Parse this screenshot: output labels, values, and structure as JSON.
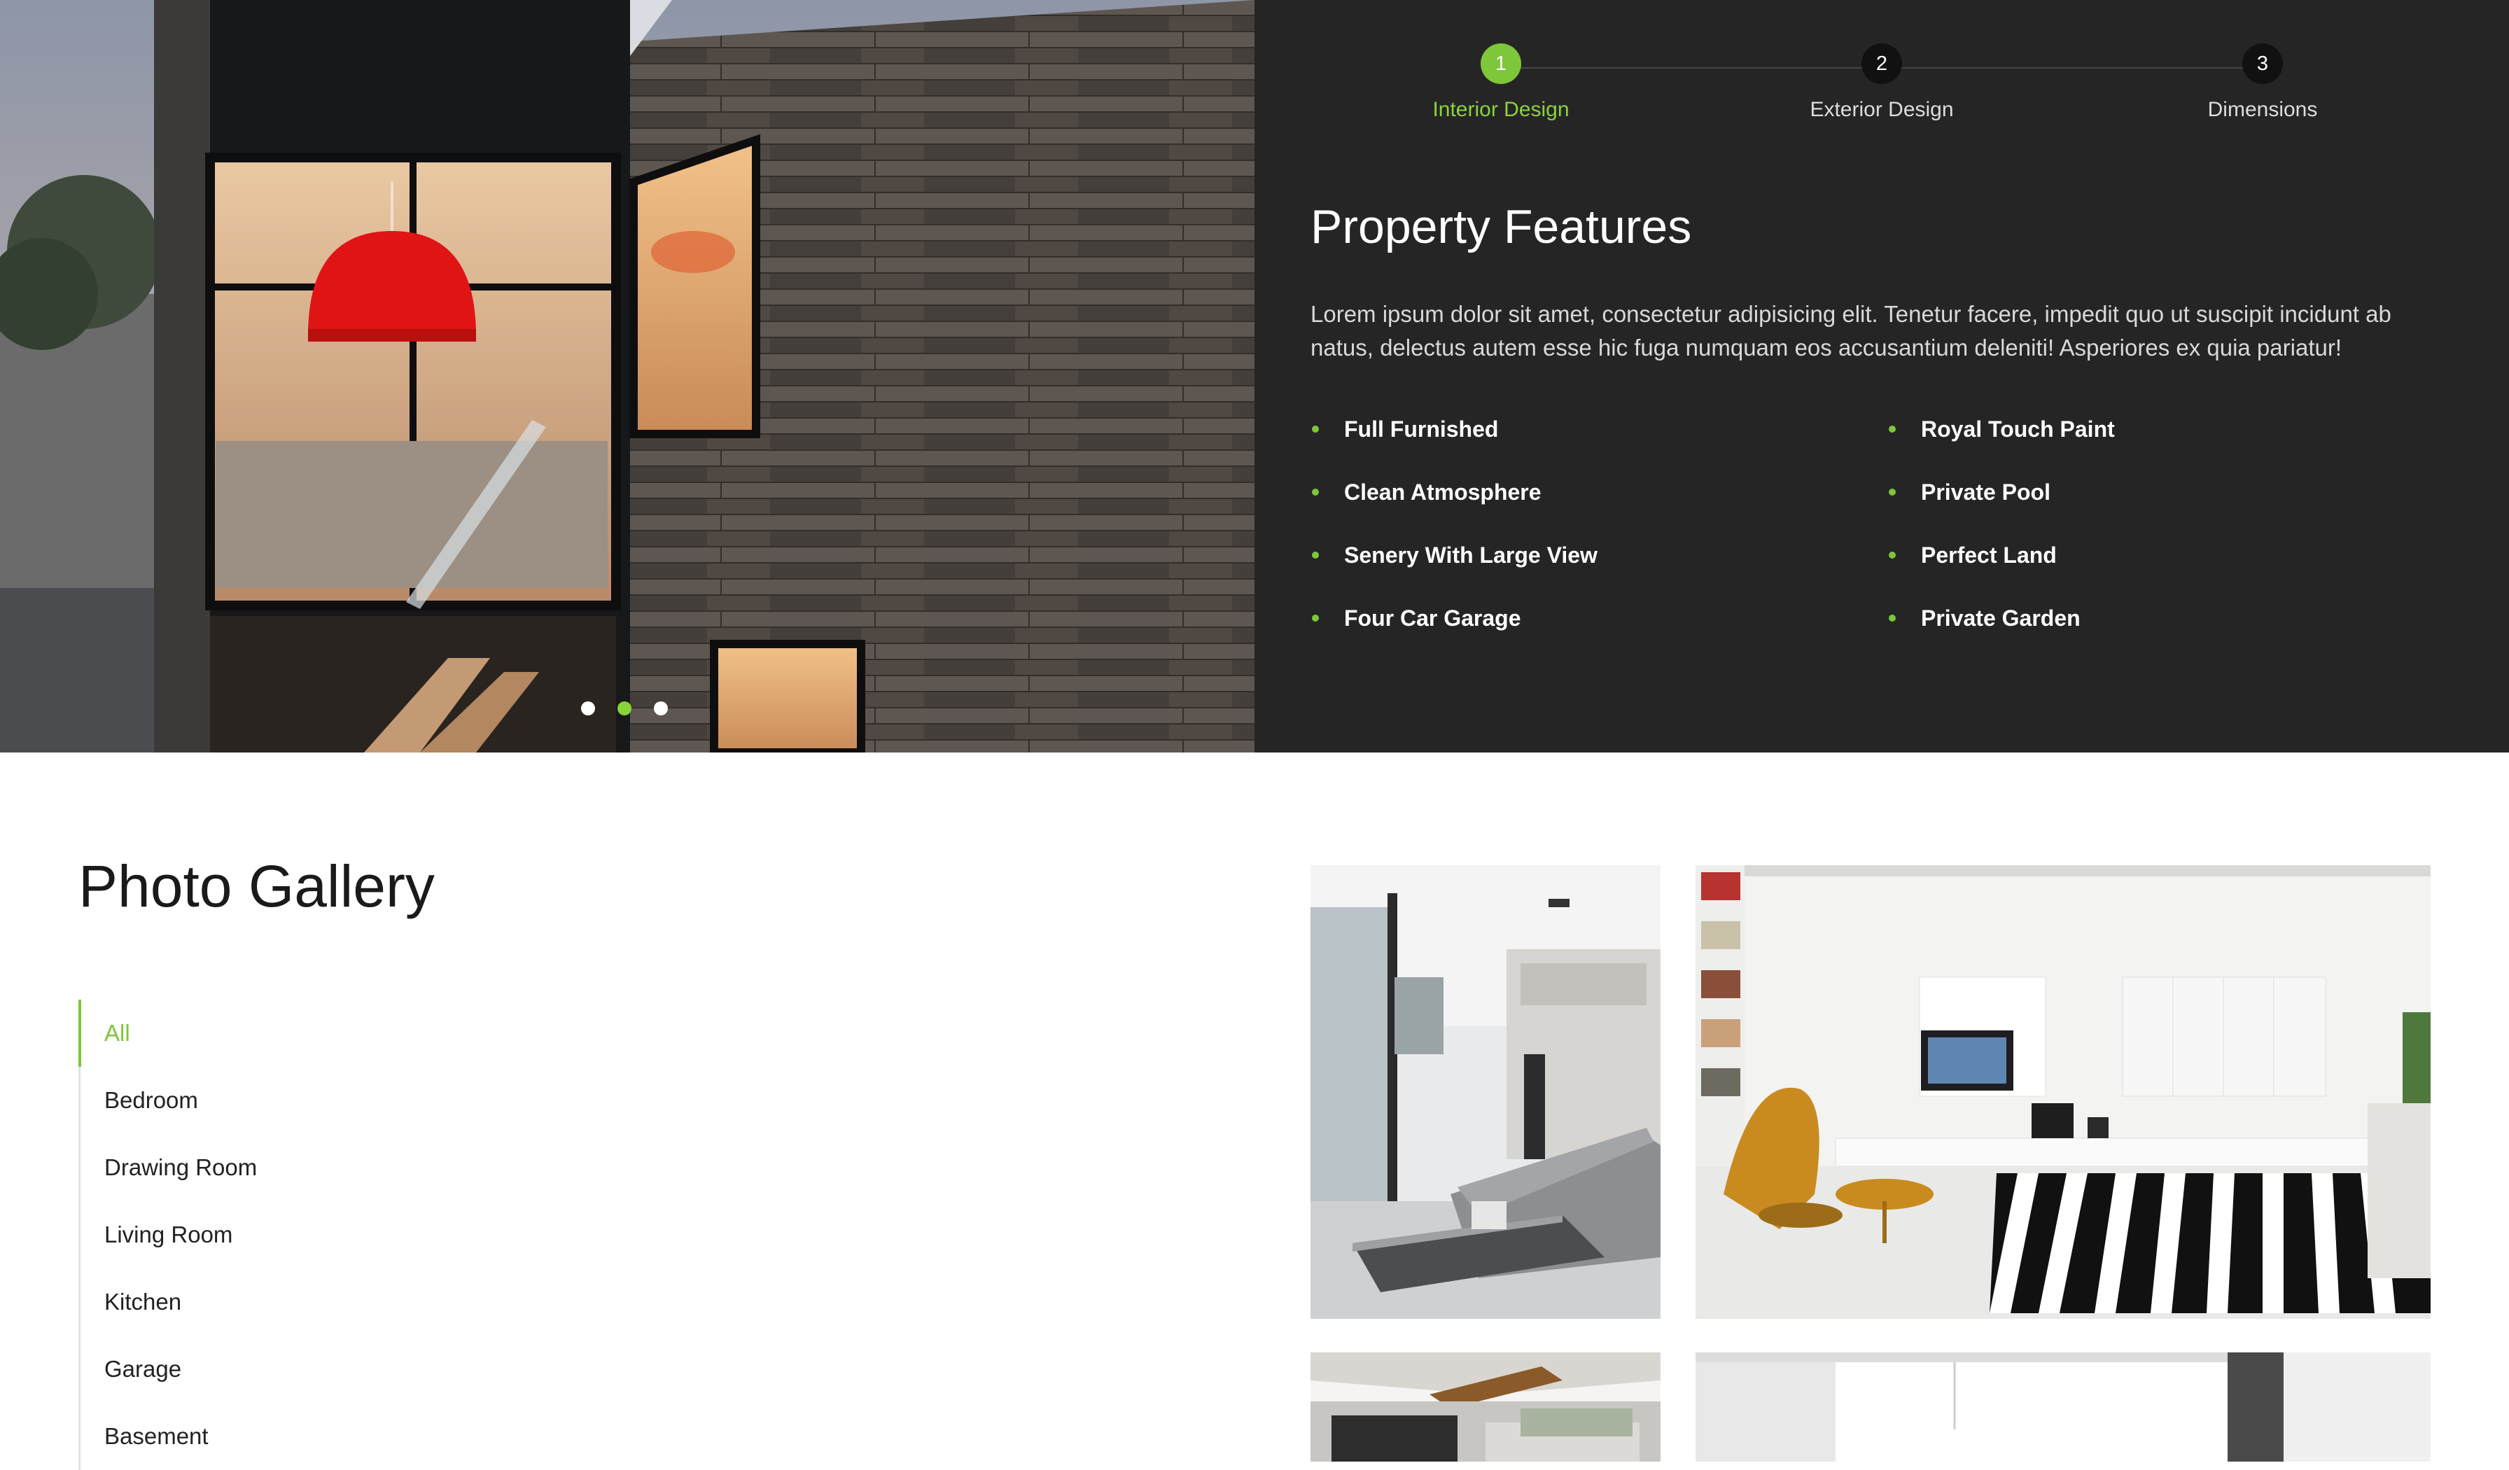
{
  "hero": {
    "slider_dots": [
      {
        "active": false
      },
      {
        "active": true
      },
      {
        "active": false
      }
    ]
  },
  "steps": [
    {
      "number": "1",
      "label": "Interior Design",
      "active": true
    },
    {
      "number": "2",
      "label": "Exterior Design",
      "active": false
    },
    {
      "number": "3",
      "label": "Dimensions",
      "active": false
    }
  ],
  "property": {
    "title": "Property Features",
    "description": "Lorem ipsum dolor sit amet, consectetur adipisicing elit. Tenetur facere, impedit quo ut suscipit incidunt ab natus, delectus autem esse hic fuga numquam eos accusantium deleniti! Asperiores ex quia pariatur!",
    "features": [
      "Full Furnished",
      "Royal Touch Paint",
      "Clean Atmosphere",
      "Private Pool",
      "Senery With Large View",
      "Perfect Land",
      "Four Car Garage",
      "Private Garden"
    ]
  },
  "gallery": {
    "title": "Photo Gallery",
    "filters": [
      {
        "label": "All",
        "active": true
      },
      {
        "label": "Bedroom",
        "active": false
      },
      {
        "label": "Drawing Room",
        "active": false
      },
      {
        "label": "Living Room",
        "active": false
      },
      {
        "label": "Kitchen",
        "active": false
      },
      {
        "label": "Garage",
        "active": false
      },
      {
        "label": "Basement",
        "active": false
      }
    ]
  },
  "colors": {
    "accent": "#7ec63a",
    "panel_bg": "#252525",
    "page_bg": "#ffffff"
  }
}
